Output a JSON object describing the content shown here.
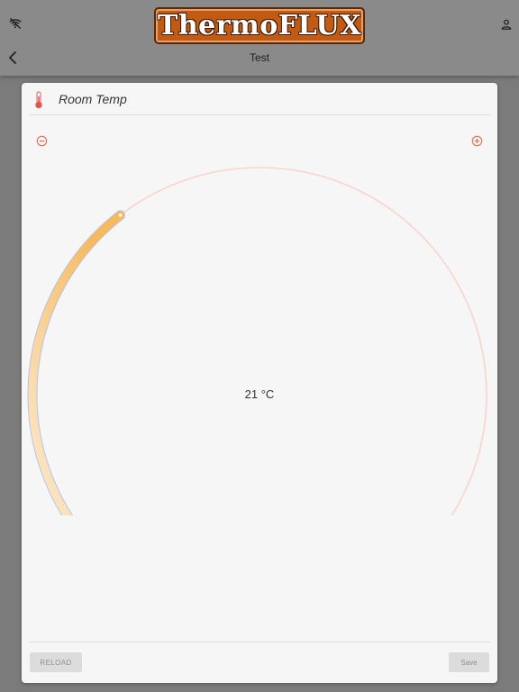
{
  "app": {
    "logo_text": "ThermoFLUX",
    "page_title": "Test"
  },
  "card": {
    "title": "Room Temp",
    "temperature": "21 °C",
    "reload_label": "RELOAD",
    "save_label": "Save"
  },
  "icons": {
    "wifi": "wifi-off-icon",
    "user": "user-icon",
    "back": "chevron-left-icon",
    "thermometer": "thermometer-icon",
    "minus": "minus-circle-icon",
    "plus": "plus-circle-icon"
  },
  "colors": {
    "accent": "#f06a4a",
    "arc_active": "#f7b95a",
    "arc_track": "#f9d4cc",
    "logo_bg": "#c35a12"
  },
  "dial": {
    "value_fraction": 0.36
  }
}
